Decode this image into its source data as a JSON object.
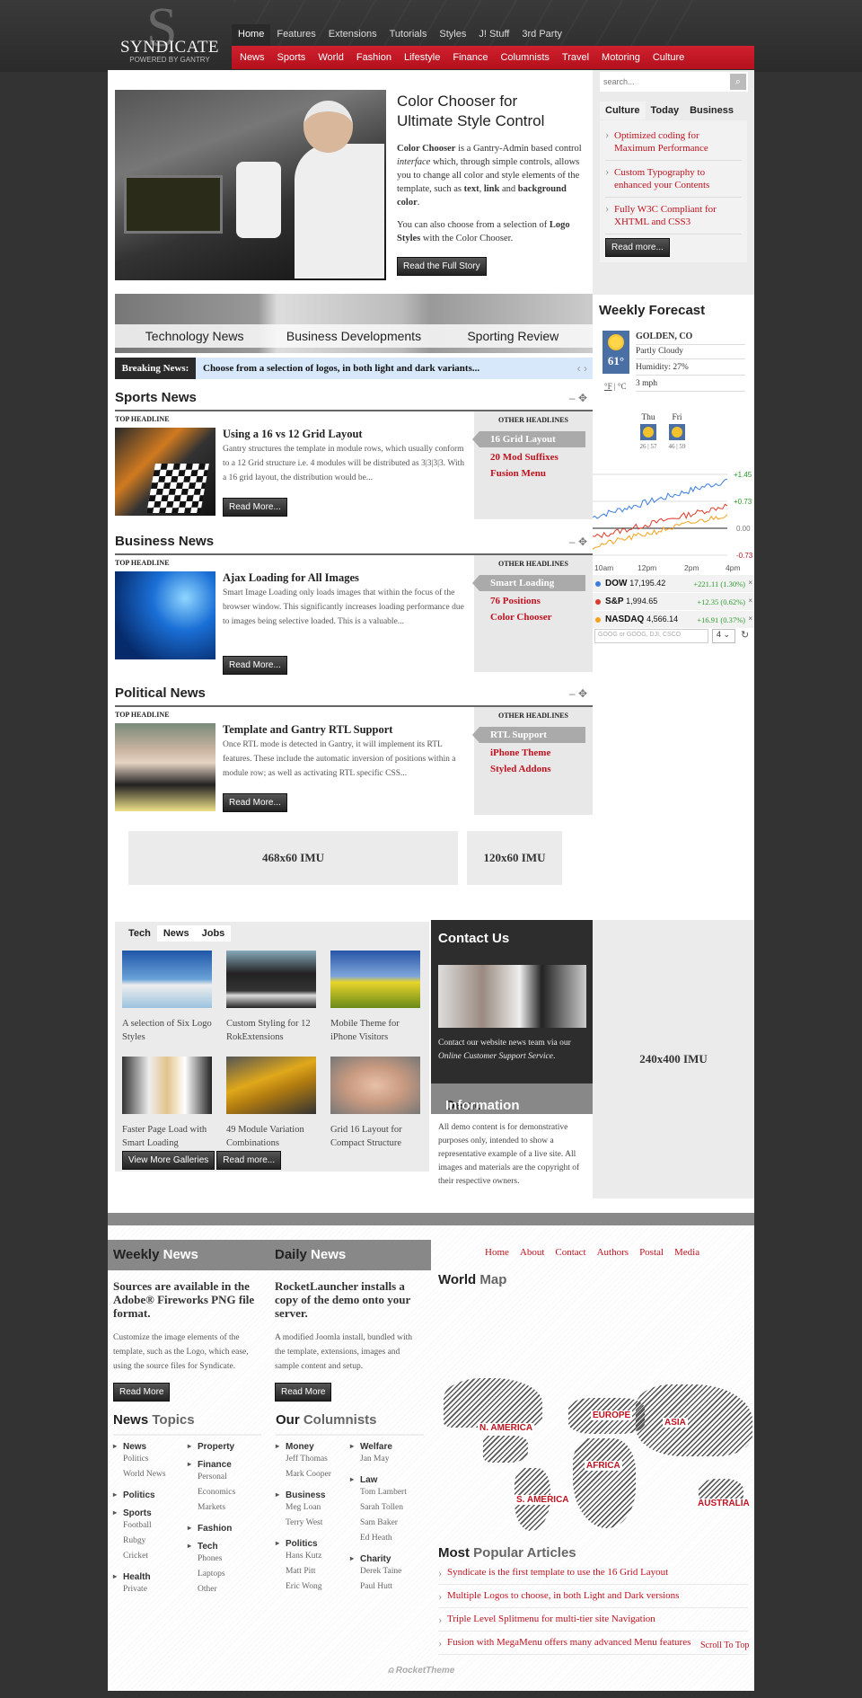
{
  "header": {
    "logo_letter": "S",
    "logo_title": "SYNDICATE",
    "logo_subtitle": "POWERED BY GANTRY",
    "top_nav": [
      "Home",
      "Features",
      "Extensions",
      "Tutorials",
      "Styles",
      "J! Stuff",
      "3rd Party"
    ],
    "top_nav_active": "Home",
    "red_nav": [
      "News",
      "Sports",
      "World",
      "Fashion",
      "Lifestyle",
      "Finance",
      "Columnists",
      "Travel",
      "Motoring",
      "Culture"
    ]
  },
  "featured": {
    "title": "Color Chooser for Ultimate Style Control",
    "p1_bold": "Color Chooser",
    "p1_a": " is a Gantry-Admin based control ",
    "p1_italic": "interface",
    "p1_b": " which, through simple controls, allows you to change all color and style elements of the template, such as ",
    "p1_bold2": "text",
    "p1_c": ", ",
    "p1_bold3": "link",
    "p1_d": " and ",
    "p1_bold4": "background color",
    "p1_e": ".",
    "p2_a": "You can also choose from a selection of ",
    "p2_bold": "Logo Styles",
    "p2_b": " with the Color Chooser.",
    "button": "Read the Full Story"
  },
  "sidebar": {
    "search_placeholder": "search...",
    "search_icon": "magnifier-icon",
    "tabs": [
      "Culture",
      "Today",
      "Business"
    ],
    "active_tab": "Culture",
    "items": [
      "Optimized coding for Maximum Performance",
      "Custom Typography to enhanced your Contents",
      "Fully W3C Compliant for XHTML and CSS3"
    ],
    "read_more": "Read more..."
  },
  "weather": {
    "title": "Weekly Forecast",
    "location": "GOLDEN, CO",
    "condition": "Partly Cloudy",
    "temp": "61°",
    "humidity": "Humidity: 27%",
    "wind": "3 mph",
    "unit_f": "°F",
    "unit_sep": " | ",
    "unit_c": "°C",
    "days": [
      {
        "name": "Thu",
        "low": "26",
        "high": "57"
      },
      {
        "name": "Fri",
        "low": "46",
        "high": "59"
      }
    ]
  },
  "stocks": {
    "y_labels": [
      "+1.45",
      "+0.73",
      "0.00",
      "-0.73"
    ],
    "x_labels": [
      "10am",
      "12pm",
      "2pm",
      "4pm"
    ],
    "rows": [
      {
        "name": "DOW",
        "value": "17,195.42",
        "change": "+221.11 (1.30%)",
        "color": "#3b7ddd"
      },
      {
        "name": "S&P",
        "value": "1,994.65",
        "change": "+12.35 (0.62%)",
        "color": "#dc3b2b"
      },
      {
        "name": "NASDAQ",
        "value": "4,566.14",
        "change": "+16.91 (0.37%)",
        "color": "#f5a21b"
      }
    ],
    "input_placeholder": "GOOG or GOOG, DJI, CSCO",
    "select_value": "4",
    "remove_icon": "×",
    "refresh_icon": "↻"
  },
  "category_strip": [
    "Technology News",
    "Business Developments",
    "Sporting Review"
  ],
  "breaking": {
    "label": "Breaking News:",
    "text": "Choose from a selection of logos, in both light and dark variants...",
    "prev": "‹",
    "next": "›"
  },
  "modules": [
    {
      "title": "Sports News",
      "top_label": "TOP HEADLINE",
      "article_title": "Using a 16 vs 12 Grid Layout",
      "article_text": "Gantry structures the template in module rows, which usually conform to a 12 Grid structure i.e. 4 modules will be distributed as 3|3|3|3. With a 16 grid layout, the distribution would be...",
      "button": "Read More...",
      "other_label": "OTHER HEADLINES",
      "others": [
        "16 Grid Layout",
        "20 Mod Suffixes",
        "Fusion Menu"
      ]
    },
    {
      "title": "Business News",
      "top_label": "TOP HEADLINE",
      "article_title": "Ajax Loading for All Images",
      "article_text": "Smart Image Loading only loads images that within the focus of the browser window. This significantly increases loading performance due to images being selective loaded. This is a valuable...",
      "button": "Read More...",
      "other_label": "OTHER HEADLINES",
      "others": [
        "Smart Loading",
        "76 Positions",
        "Color Chooser"
      ]
    },
    {
      "title": "Political News",
      "top_label": "TOP HEADLINE",
      "article_title": "Template and Gantry RTL Support",
      "article_text": "Once RTL mode is detected in Gantry, it will implement its RTL features. These include the automatic inversion of positions within a module row; as well as activating RTL specific CSS...",
      "button": "Read More...",
      "other_label": "OTHER HEADLINES",
      "others": [
        "RTL Support",
        "iPhone Theme",
        "Styled Addons"
      ]
    }
  ],
  "module_controls": {
    "minimize": "–",
    "move": "✥"
  },
  "imu": {
    "wide": "468x60 IMU",
    "small": "120x60 IMU",
    "tall": "240x400 IMU"
  },
  "gallery": {
    "tabs": [
      "Tech",
      "News",
      "Jobs"
    ],
    "active_tab": "Tech",
    "items": [
      "A selection of Six Logo Styles",
      "Custom Styling for 12 RokExtensions",
      "Mobile Theme for iPhone Visitors",
      "Faster Page Load with Smart Loading",
      "49 Module Variation Combinations",
      "Grid 16 Layout for Compact Structure"
    ],
    "btn_more": "View More Galleries",
    "btn_read": "Read more..."
  },
  "contact": {
    "title": "Contact Us",
    "text": "Contact our website news team via our ",
    "link": "Online Customer Support Service",
    "end": "."
  },
  "demo": {
    "title_a": "Demo",
    "title_b": " Information",
    "text": "All demo content is for demonstrative purposes only, intended to show a representative example of a live site. All images and materials are the copyright of their respective owners."
  },
  "weekly": {
    "title_a": "Weekly",
    "title_b": " News",
    "headline": "Sources are available in the Adobe® Fireworks PNG file format.",
    "text": "Customize the image elements of the template, such as the Logo, which ease, using the source files for Syndicate.",
    "button": "Read More"
  },
  "daily": {
    "title_a": "Daily",
    "title_b": " News",
    "headline": "RocketLauncher installs a copy of the demo onto your server.",
    "text": "A modified Joomla install, bundled with the template, extensions, images and sample content and setup.",
    "button": "Read More"
  },
  "footer_nav": [
    "Home",
    "About",
    "Contact",
    "Authors",
    "Postal",
    "Media"
  ],
  "news_topics": {
    "title_a": "News",
    "title_b": " Topics",
    "col1": [
      {
        "cat": "News",
        "subs": [
          "Politics",
          "World News"
        ]
      },
      {
        "cat": "Politics",
        "subs": []
      },
      {
        "cat": "Sports",
        "subs": [
          "Football",
          "Rubgy",
          "Cricket"
        ]
      },
      {
        "cat": "Health",
        "subs": [
          "Private"
        ]
      }
    ],
    "col2": [
      {
        "cat": "Property",
        "subs": []
      },
      {
        "cat": "Finance",
        "subs": [
          "Personal",
          "Economics",
          "Markets"
        ]
      },
      {
        "cat": "Fashion",
        "subs": []
      },
      {
        "cat": "Tech",
        "subs": [
          "Phones",
          "Laptops",
          "Other"
        ]
      }
    ]
  },
  "columnists": {
    "title_a": "Our",
    "title_b": " Columnists",
    "col1": [
      {
        "cat": "Money",
        "subs": [
          "Jeff Thomas",
          "Mark Cooper"
        ]
      },
      {
        "cat": "Business",
        "subs": [
          "Meg Loan",
          "Terry West"
        ]
      },
      {
        "cat": "Politics",
        "subs": [
          "Hans Kutz",
          "Matt Pitt",
          "Eric Wong"
        ]
      }
    ],
    "col2": [
      {
        "cat": "Welfare",
        "subs": [
          "Jan May"
        ]
      },
      {
        "cat": "Law",
        "subs": [
          "Tom Lambert",
          "Sarah Tollen",
          "Sam Baker",
          "Ed Heath"
        ]
      },
      {
        "cat": "Charity",
        "subs": [
          "Derek Taine",
          "Paul Hutt"
        ]
      }
    ]
  },
  "world_map": {
    "title_a": "World",
    "title_b": " Map",
    "labels": [
      "N. AMERICA",
      "EUROPE",
      "ASIA",
      "AFRICA",
      "S. AMERICA",
      "AUSTRALIA"
    ]
  },
  "popular": {
    "title_a": "Most",
    "title_b": " Popular Articles",
    "items": [
      "Syndicate is the first template to use the 16 Grid Layout",
      "Multiple Logos to choose, in both Light and Dark versions",
      "Triple Level Splitmenu for multi-tier site Navigation",
      "Fusion with MegaMenu offers many advanced Menu features"
    ]
  },
  "scroll_top": "Scroll To Top",
  "branding": "RocketTheme"
}
